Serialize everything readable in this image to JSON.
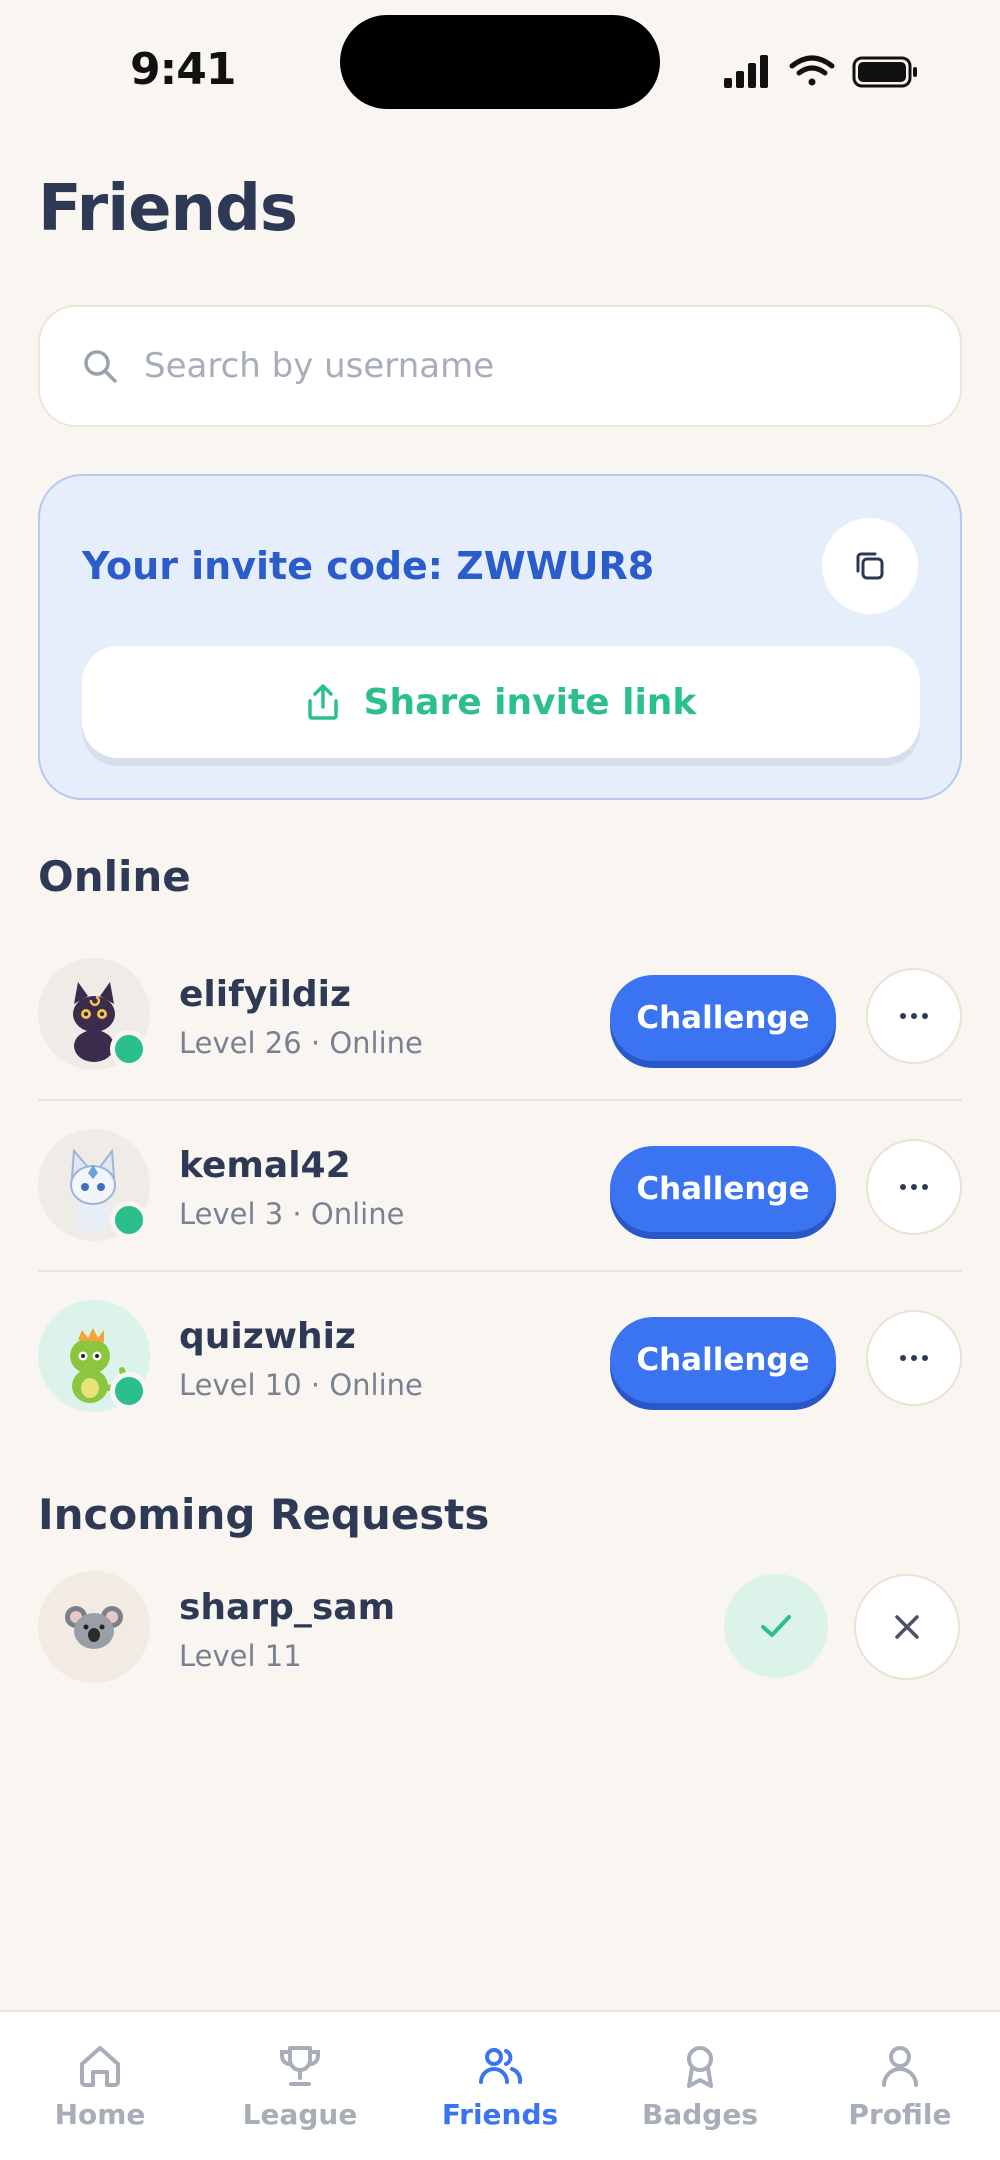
{
  "status_bar": {
    "time": "9:41"
  },
  "page": {
    "title": "Friends"
  },
  "search": {
    "placeholder": "Search by username",
    "value": ""
  },
  "invite": {
    "code_label": "Your invite code: ZWWUR8",
    "share_label": "Share invite link"
  },
  "sections": {
    "online": "Online",
    "requests": "Incoming Requests"
  },
  "friends": [
    {
      "name": "elifyildiz",
      "meta": "Level 26 · Online",
      "action": "Challenge",
      "avatar": "cat-avatar"
    },
    {
      "name": "kemal42",
      "meta": "Level 3 · Online",
      "action": "Challenge",
      "avatar": "wolf-avatar"
    },
    {
      "name": "quizwhiz",
      "meta": "Level 10 · Online",
      "action": "Challenge",
      "avatar": "dragon-avatar"
    }
  ],
  "requests": [
    {
      "name": "sharp_sam",
      "meta": "Level 11",
      "avatar": "koala-avatar"
    }
  ],
  "tabs": [
    {
      "label": "Home",
      "icon": "home-icon"
    },
    {
      "label": "League",
      "icon": "trophy-icon"
    },
    {
      "label": "Friends",
      "icon": "friends-icon",
      "active": true
    },
    {
      "label": "Badges",
      "icon": "badge-icon"
    },
    {
      "label": "Profile",
      "icon": "profile-icon"
    }
  ],
  "colors": {
    "accent": "#3b74f1",
    "success": "#2bbf8e",
    "background": "#f9f6f1",
    "invite_bg": "#e6eefc"
  }
}
